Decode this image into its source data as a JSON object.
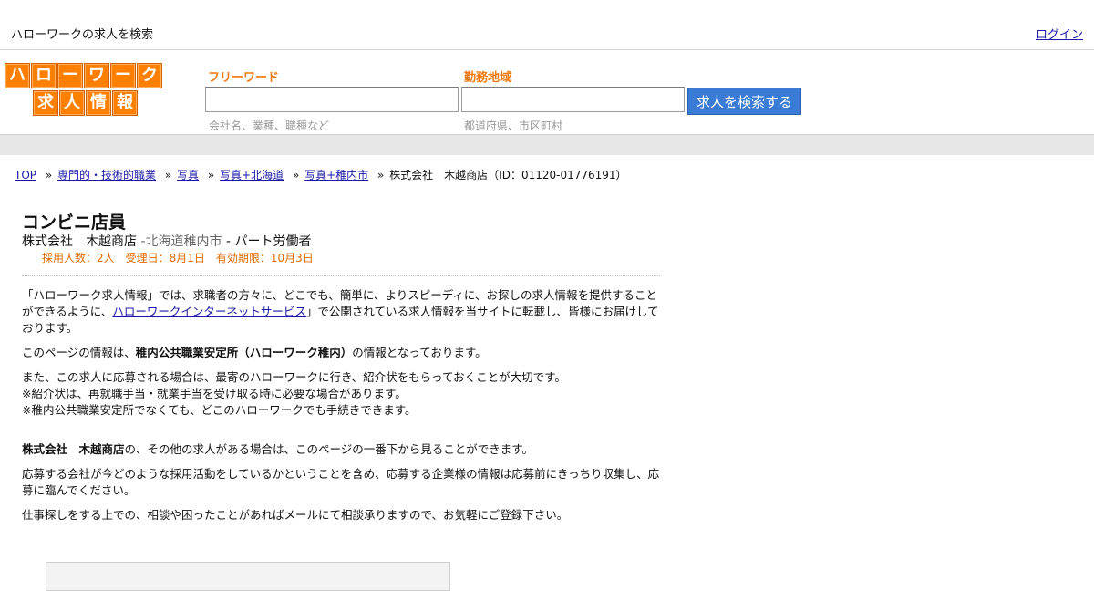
{
  "topbar": {
    "tagline": "ハローワークの求人を検索",
    "login": "ログイン"
  },
  "logo": {
    "row1": [
      "ハ",
      "ロ",
      "ー",
      "ワ",
      "ー",
      "ク"
    ],
    "row2": [
      "求",
      "人",
      "情",
      "報"
    ]
  },
  "search": {
    "free_label": "フリーワード",
    "free_value": "",
    "free_hint": "会社名、業種、職種など",
    "area_label": "勤務地域",
    "area_value": "",
    "area_hint": "都道府県、市区町村",
    "button": "求人を検索する"
  },
  "breadcrumb": {
    "items": [
      "TOP",
      "専門的・技術的職業",
      "写真",
      "写真+北海道",
      "写真+稚内市"
    ],
    "current": "株式会社　木越商店（ID：01120-01776191）",
    "separator": "»"
  },
  "job": {
    "title": "コンビニ店員",
    "company": "株式会社　木越商店",
    "location": "北海道稚内市",
    "employment": "パート労働者",
    "meta": "採用人数：2人　受理日：8月1日　有効期限：10月3日"
  },
  "body": {
    "p1_a": "「ハローワーク求人情報」では、求職者の方々に、どこでも、簡単に、よりスピーディに、お探しの求人情報を提供することができるように、",
    "p1_link": "ハローワークインターネットサービス",
    "p1_b": "」で公開されている求人情報を当サイトに転載し、皆様にお届けしております。",
    "p2_a": "このページの情報は、",
    "p2_bold": "稚内公共職業安定所（ハローワーク稚内）",
    "p2_b": "の情報となっております。",
    "p3_1": "また、この求人に応募される場合は、最寄のハローワークに行き、紹介状をもらっておくことが大切です。",
    "p3_2": "※紹介状は、再就職手当・就業手当を受け取る時に必要な場合があります。",
    "p3_3": "※稚内公共職業安定所でなくても、どこのハローワークでも手続きできます。",
    "p4_bold": "株式会社　木越商店",
    "p4_b": "の、その他の求人がある場合は、このページの一番下から見ることができます。",
    "p5": "応募する会社が今どのような採用活動をしているかということを含め、応募する企業様の情報は応募前にきっちり収集し、応募に臨んでください。",
    "p6": "仕事探しをする上での、相談や困ったことがあればメールにて相談承りますので、お気軽にご登録下さい。"
  }
}
